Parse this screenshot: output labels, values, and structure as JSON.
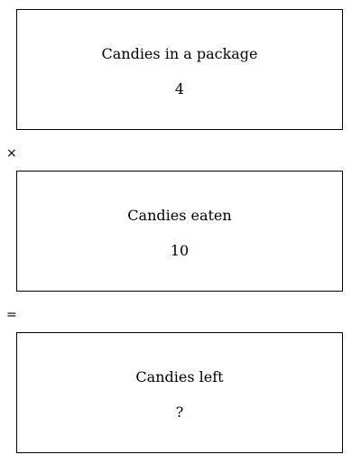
{
  "boxes": [
    {
      "label": "Candies in a package",
      "value": "4"
    },
    {
      "label": "Candies eaten",
      "value": "10"
    },
    {
      "label": "Candies left",
      "value": "?"
    }
  ],
  "operators": {
    "multiply": "×",
    "equals": "="
  }
}
